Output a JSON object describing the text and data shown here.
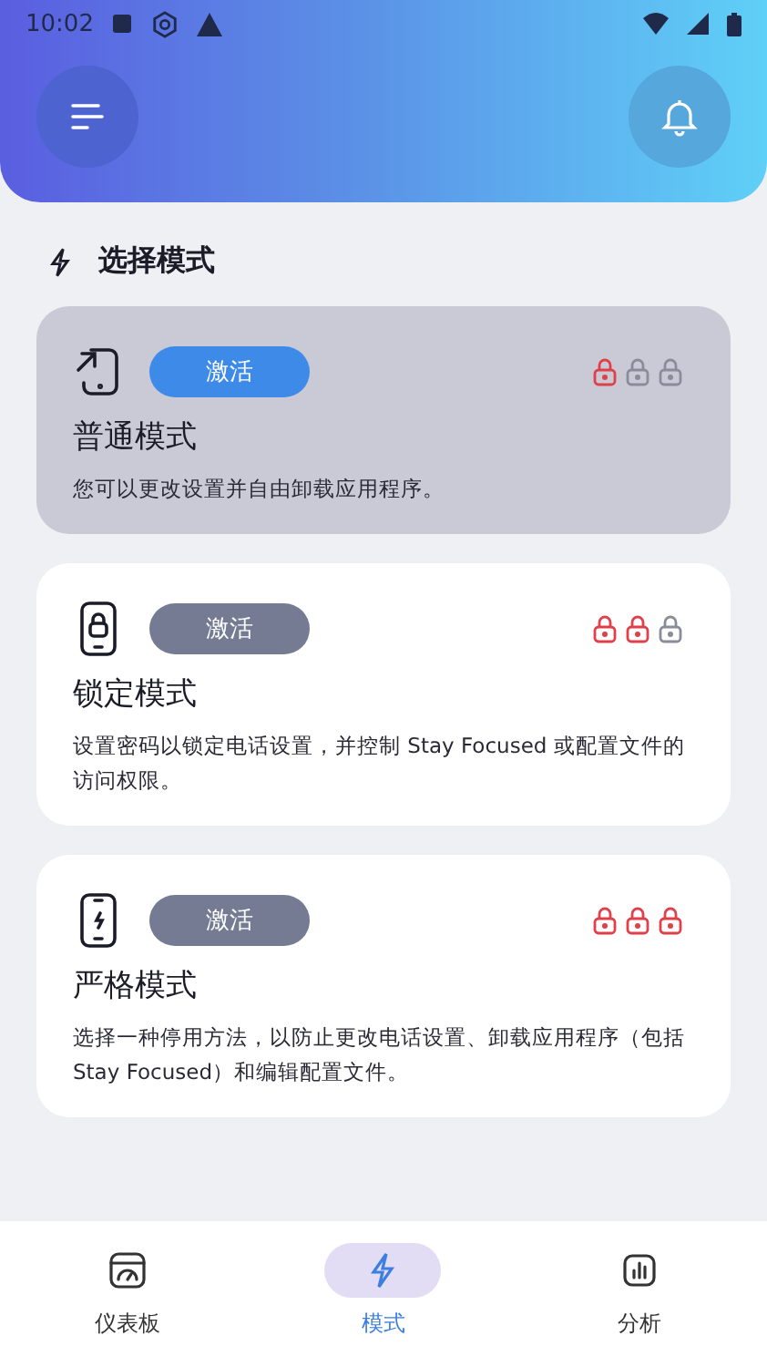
{
  "status_bar": {
    "time": "10:02"
  },
  "section": {
    "title": "选择模式"
  },
  "modes": [
    {
      "kind": "normal",
      "title": "普通模式",
      "description": "您可以更改设置并自由卸载应用程序。",
      "button": "激活",
      "selected": true,
      "locks": [
        {
          "on": true
        },
        {
          "on": false
        },
        {
          "on": false
        }
      ]
    },
    {
      "kind": "locked",
      "title": "锁定模式",
      "description": "设置密码以锁定电话设置，并控制 Stay Focused 或配置文件的访问权限。",
      "button": "激活",
      "selected": false,
      "locks": [
        {
          "on": true
        },
        {
          "on": true
        },
        {
          "on": false
        }
      ]
    },
    {
      "kind": "strict",
      "title": "严格模式",
      "description": "选择一种停用方法，以防止更改电话设置、卸载应用程序（包括 Stay Focused）和编辑配置文件。",
      "button": "激活",
      "selected": false,
      "locks": [
        {
          "on": true
        },
        {
          "on": true
        },
        {
          "on": true
        }
      ]
    }
  ],
  "nav": [
    {
      "kind": "dashboard",
      "label": "仪表板",
      "selected": false
    },
    {
      "kind": "modes",
      "label": "模式",
      "selected": true
    },
    {
      "kind": "stats",
      "label": "分析",
      "selected": false
    }
  ]
}
